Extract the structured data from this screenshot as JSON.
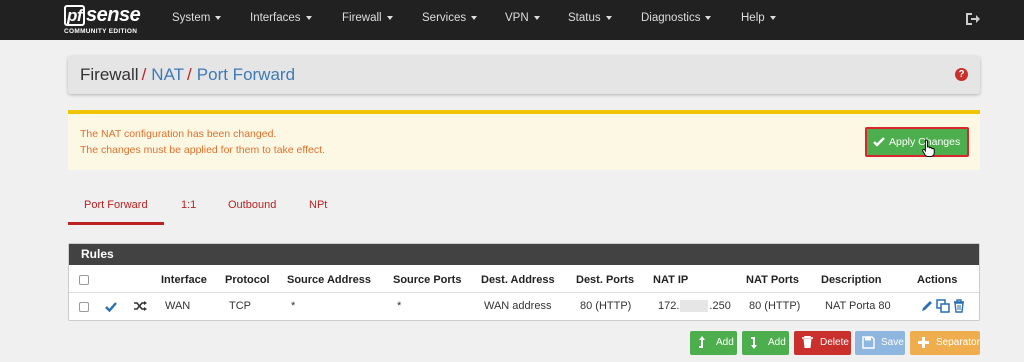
{
  "navbar": {
    "logo_main": "sense",
    "logo_pf": "pf",
    "logo_sub": "COMMUNITY EDITION",
    "menu": [
      "System",
      "Interfaces",
      "Firewall",
      "Services",
      "VPN",
      "Status",
      "Diagnostics",
      "Help"
    ]
  },
  "breadcrumb": {
    "part1": "Firewall",
    "part2": "NAT",
    "part3": "Port Forward"
  },
  "alert": {
    "line1": "The NAT configuration has been changed.",
    "line2": "The changes must be applied for them to take effect.",
    "apply_label": "Apply Changes"
  },
  "tabs": [
    "Port Forward",
    "1:1",
    "Outbound",
    "NPt"
  ],
  "rules": {
    "title": "Rules",
    "headers": [
      "Interface",
      "Protocol",
      "Source Address",
      "Source Ports",
      "Dest. Address",
      "Dest. Ports",
      "NAT IP",
      "NAT Ports",
      "Description",
      "Actions"
    ],
    "row": {
      "interface": "WAN",
      "protocol": "TCP",
      "source_address": "*",
      "source_ports": "*",
      "dest_address": "WAN address",
      "dest_ports": "80 (HTTP)",
      "nat_ip_prefix": "172.",
      "nat_ip_suffix": ".250",
      "nat_ports": "80 (HTTP)",
      "description": "NAT Porta 80"
    }
  },
  "buttons": {
    "add1": "Add",
    "add2": "Add",
    "delete": "Delete",
    "save": "Save",
    "separator": "Separator"
  },
  "colors": {
    "navbar": "#212121",
    "accent_red": "#bb2222",
    "link_blue": "#3d7ab8",
    "success": "#4cae4c",
    "warning_text": "#e0712b"
  }
}
